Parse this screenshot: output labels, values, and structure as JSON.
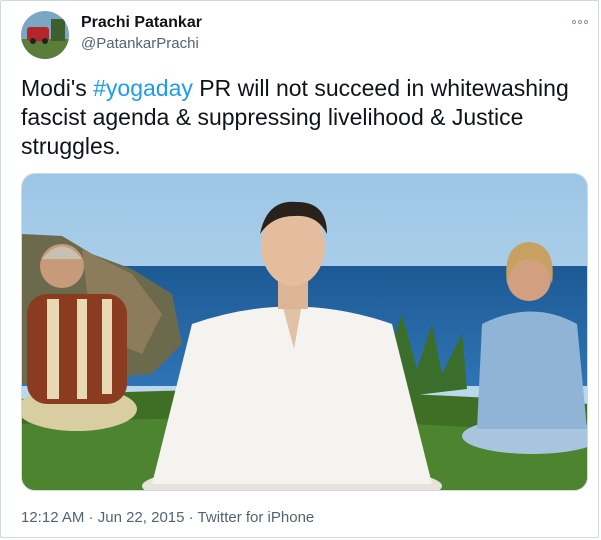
{
  "author": {
    "display_name": "Prachi Patankar",
    "handle": "@PatankarPrachi"
  },
  "tweet": {
    "text_before": "Modi's ",
    "hashtag": "#yogaday",
    "text_after": " PR will not succeed in whitewashing fascist agenda & suppressing livelihood & Justice struggles."
  },
  "media": {
    "description_icon": "photo-of-three-men-meditating"
  },
  "meta": {
    "time": "12:12 AM",
    "separator1": " · ",
    "date": "Jun 22, 2015",
    "separator2": " · ",
    "source": "Twitter for iPhone"
  },
  "colors": {
    "link": "#1d9bf0",
    "muted": "#536471"
  },
  "icons": {
    "more": "more-options-icon"
  }
}
